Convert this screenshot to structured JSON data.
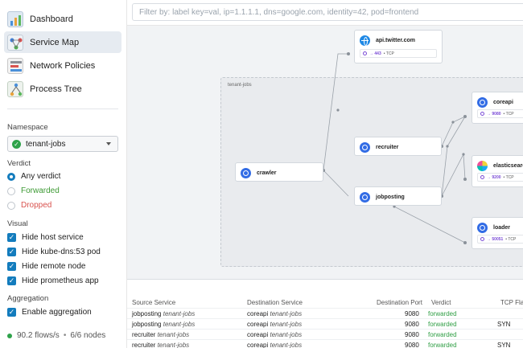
{
  "nav": {
    "items": [
      {
        "label": "Dashboard",
        "icon": "dashboard-icon"
      },
      {
        "label": "Service Map",
        "icon": "service-map-icon"
      },
      {
        "label": "Network Policies",
        "icon": "network-policies-icon"
      },
      {
        "label": "Process Tree",
        "icon": "process-tree-icon"
      }
    ]
  },
  "namespace": {
    "title": "Namespace",
    "value": "tenant-jobs"
  },
  "verdict": {
    "title": "Verdict",
    "options": [
      "Any verdict",
      "Forwarded",
      "Dropped"
    ],
    "selected": "Any verdict",
    "colors": {
      "forwarded": "#3d9a34",
      "dropped": "#d9534f"
    }
  },
  "visual": {
    "title": "Visual",
    "options": [
      "Hide host service",
      "Hide kube-dns:53 pod",
      "Hide remote node",
      "Hide prometheus app"
    ]
  },
  "aggregation": {
    "title": "Aggregation",
    "option": "Enable aggregation"
  },
  "status": {
    "flows": "90.2 flows/s",
    "separator": "•",
    "nodes": "6/6 nodes"
  },
  "filter": {
    "placeholder": "Filter by: label key=val, ip=1.1.1.1, dns=google.com, identity=42, pod=frontend"
  },
  "map": {
    "namespace_label": "tenant-jobs",
    "nodes": {
      "twitter": {
        "title": "api.twitter.com",
        "port": "→ 443",
        "proto": "• TCP"
      },
      "crawler": {
        "title": "crawler"
      },
      "recruiter": {
        "title": "recruiter"
      },
      "jobposting": {
        "title": "jobposting"
      },
      "coreapi": {
        "title": "coreapi",
        "port": "→ 9080",
        "proto": "• TCP"
      },
      "elastic": {
        "title": "elasticsearch",
        "port": "→ 9200",
        "proto": "• TCP"
      },
      "loader": {
        "title": "loader",
        "port": "→ 50051",
        "proto": "• TCP"
      }
    }
  },
  "table": {
    "headers": [
      "Source Service",
      "Destination Service",
      "Destination Port",
      "Verdict",
      "TCP Flags"
    ],
    "rows": [
      {
        "src": "jobposting",
        "src_ns": "tenant-jobs",
        "dst": "coreapi",
        "dst_ns": "tenant-jobs",
        "port": "9080",
        "verdict": "forwarded",
        "flags": ""
      },
      {
        "src": "jobposting",
        "src_ns": "tenant-jobs",
        "dst": "coreapi",
        "dst_ns": "tenant-jobs",
        "port": "9080",
        "verdict": "forwarded",
        "flags": "SYN"
      },
      {
        "src": "recruiter",
        "src_ns": "tenant-jobs",
        "dst": "coreapi",
        "dst_ns": "tenant-jobs",
        "port": "9080",
        "verdict": "forwarded",
        "flags": ""
      },
      {
        "src": "recruiter",
        "src_ns": "tenant-jobs",
        "dst": "coreapi",
        "dst_ns": "tenant-jobs",
        "port": "9080",
        "verdict": "forwarded",
        "flags": "SYN"
      }
    ]
  }
}
